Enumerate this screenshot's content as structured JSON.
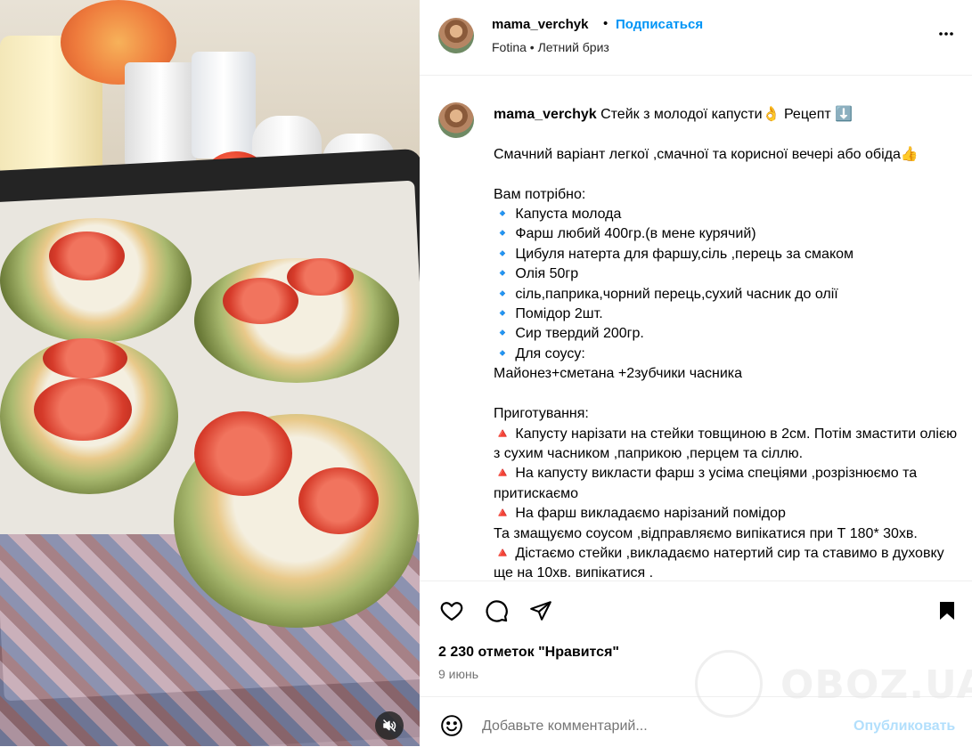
{
  "post": {
    "username": "mama_verchyk",
    "separator": "•",
    "follow_label": "Подписаться",
    "subline": "Fotina • Летний бриз"
  },
  "caption": {
    "username": "mama_verchyk",
    "text": " Стейк з молодої капусти👌 Рецепт ⬇️\n\nСмачний варіант легкої ,смачної та корисної вечері або обіда👍\n\nВам потрібно:\n🔹 Капуста молода\n🔹 Фарш любий 400гр.(в мене курячий)\n🔹 Цибуля натерта для фаршу,сіль ,перець за смаком\n🔹 Олія 50гр\n🔹 сіль,паприка,чорний перець,сухий часник до олії\n🔹 Помідор 2шт.\n🔹 Сир твердий 200гр.\n🔹 Для соусу:\nМайонез+сметана +2зубчики часника\n\nПриготування:\n🔺 Капусту нарізати на стейки товщиною в 2см. Потім змастити олією з сухим часником ,паприкою ,перцем та сіллю.\n🔺 На капусту викласти фарш з усіма спеціями ,розрізнюємо та притискаємо\n🔺 На фарш викладаємо нарізаний помідор\nТа змащуємо соусом ,відправляємо випікатися при Т 180* 30хв.\n🔺 Дістаємо стейки ,викладаємо натертий сир та ставимо в духовку ще на 10хв. випікатися ."
  },
  "stats": {
    "likes": "2 230 отметок \"Нравится\"",
    "date": "9 июнь"
  },
  "comment": {
    "placeholder": "Добавьте комментарий...",
    "publish_label": "Опубликовать"
  },
  "watermark": {
    "text": "OBOZ.UA"
  },
  "colors": {
    "accent": "#0095f6",
    "publish_disabled": "#b2dffc",
    "muted_text": "#737373"
  },
  "icons": [
    "heart-icon",
    "comment-icon",
    "share-icon",
    "bookmark-icon",
    "more-icon",
    "mute-icon",
    "emoji-icon"
  ]
}
